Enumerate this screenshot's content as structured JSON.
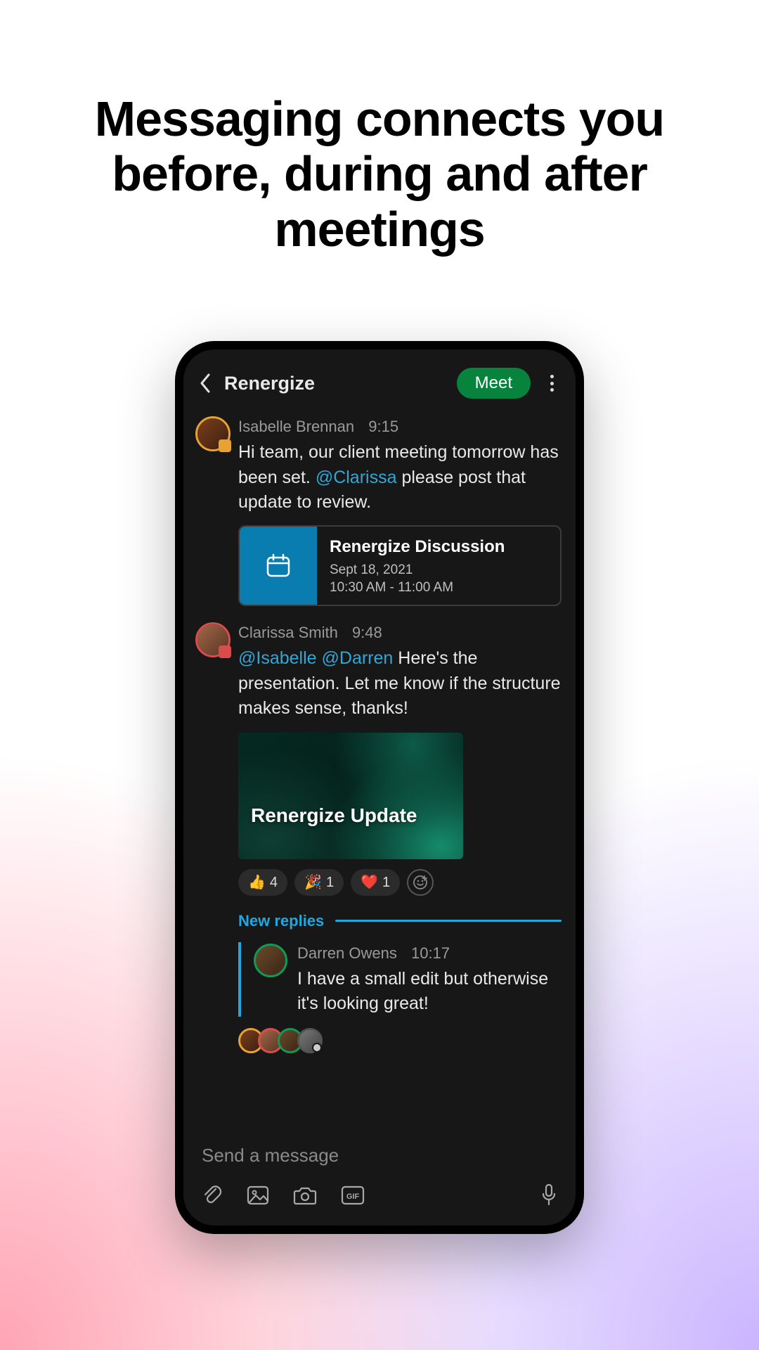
{
  "hero": {
    "title": "Messaging connects you before, during and after meetings"
  },
  "header": {
    "title": "Renergize",
    "meet_label": "Meet"
  },
  "messages": [
    {
      "author": "Isabelle Brennan",
      "time": "9:15",
      "text_pre": "Hi team, our client meeting tomorrow has been set. ",
      "mention": "@Clarissa",
      "text_post": " please post that update to review.",
      "event": {
        "title": "Renergize Discussion",
        "date": "Sept 18, 2021",
        "time": "10:30 AM - 11:00 AM"
      }
    },
    {
      "author": "Clarissa Smith",
      "time": "9:48",
      "mention1": "@Isabelle",
      "mention2": "@Darren",
      "text_post": " Here's the presentation. Let me know if the structure makes sense, thanks!",
      "attachment_title": "Renergize Update",
      "reactions": [
        {
          "emoji": "👍",
          "count": "4"
        },
        {
          "emoji": "🎉",
          "count": "1"
        },
        {
          "emoji": "❤️",
          "count": "1"
        }
      ]
    }
  ],
  "new_replies_label": "New replies",
  "reply": {
    "author": "Darren Owens",
    "time": "10:17",
    "text": "I have a small edit but otherwise it's looking great!"
  },
  "composer": {
    "placeholder": "Send a message",
    "gif_label": "GIF"
  }
}
